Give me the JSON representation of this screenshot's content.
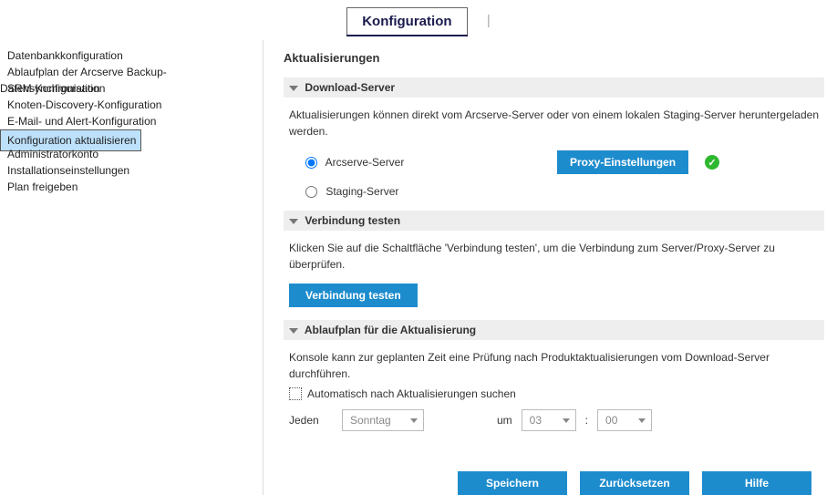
{
  "tab": "Konfiguration",
  "sidebar": {
    "items": [
      "Datenbankkonfiguration",
      "Ablaufplan der Arcserve Backup-Datensynchronisation",
      "SRM-Konfiguration",
      "Knoten-Discovery-Konfiguration",
      "E-Mail- und Alert-Konfiguration",
      "Konfiguration aktualisieren",
      "Administratorkonto",
      "Installationseinstellungen",
      "Plan freigeben"
    ],
    "selectedIndex": 5
  },
  "main": {
    "title": "Aktualisierungen",
    "download": {
      "header": "Download-Server",
      "desc": "Aktualisierungen können direkt vom Arcserve-Server oder von einem lokalen Staging-Server heruntergeladen werden.",
      "opt1": "Arcserve-Server",
      "opt2": "Staging-Server",
      "proxy_btn": "Proxy-Einstellungen",
      "selected": "opt1",
      "status_ok": true
    },
    "test": {
      "header": "Verbindung testen",
      "desc": "Klicken Sie auf die Schaltfläche 'Verbindung testen', um die Verbindung zum Server/Proxy-Server zu überprüfen.",
      "btn": "Verbindung testen"
    },
    "schedule": {
      "header": "Ablaufplan für die Aktualisierung",
      "desc": "Konsole kann zur geplanten Zeit eine Prüfung nach Produktaktualisierungen vom Download-Server durchführen.",
      "check_label": "Automatisch nach Aktualisierungen suchen",
      "every_label": "Jeden",
      "day": "Sonntag",
      "at_label": "um",
      "hour": "03",
      "colon": ":",
      "minute": "00"
    },
    "footer": {
      "save": "Speichern",
      "reset": "Zurücksetzen",
      "help": "Hilfe"
    }
  }
}
